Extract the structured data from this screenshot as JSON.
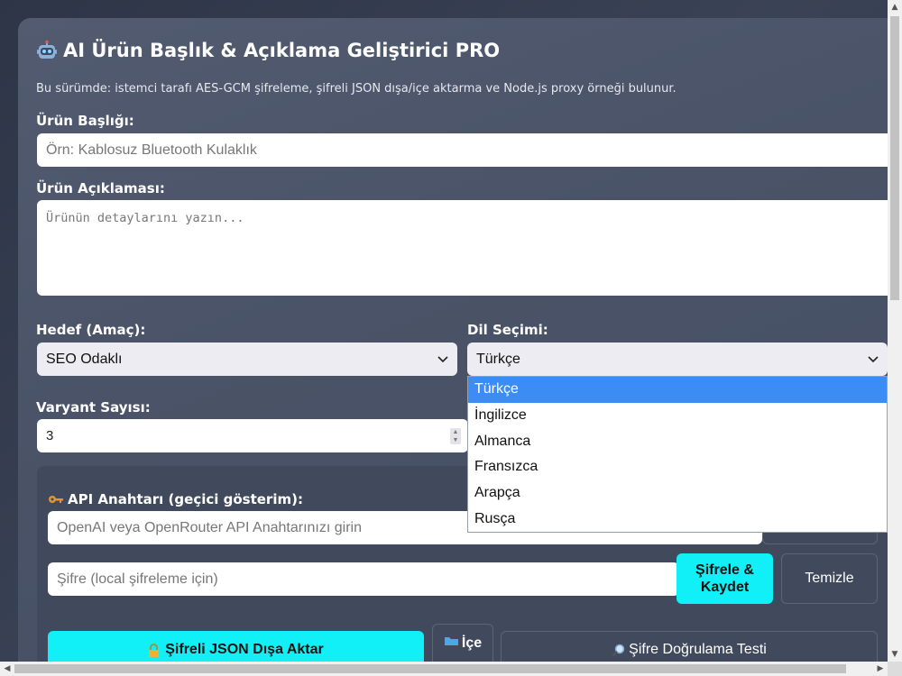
{
  "header": {
    "title": "AI Ürün Başlık & Açıklama Geliştirici PRO",
    "title_icon": "robot-icon",
    "subtitle": "Bu sürümde: istemci tarafı AES-GCM şifreleme, şifreli JSON dışa/içe aktarma ve Node.js proxy örneği bulunur."
  },
  "form": {
    "product_title": {
      "label": "Ürün Başlığı:",
      "placeholder": "Örn: Kablosuz Bluetooth Kulaklık",
      "value": ""
    },
    "product_desc": {
      "label": "Ürün Açıklaması:",
      "placeholder": "Ürünün detaylarını yazın...",
      "value": ""
    },
    "goal": {
      "label": "Hedef (Amaç):",
      "selected": "SEO Odaklı"
    },
    "language": {
      "label": "Dil Seçimi:",
      "selected": "Türkçe",
      "options": [
        "Türkçe",
        "İngilizce",
        "Almanca",
        "Fransızca",
        "Arapça",
        "Rusça"
      ]
    },
    "variants": {
      "label": "Varyant Sayısı:",
      "value": "3"
    }
  },
  "api_panel": {
    "label": "API Anahtarı (geçici gösterim):",
    "label_icon": "key-icon",
    "api_key_placeholder": "OpenAI veya OpenRouter API Anahtarınızı girin",
    "password_placeholder": "Şifre (local şifreleme için)",
    "encrypt_save": "Şifrele & Kaydet",
    "clear": "Temizle",
    "export_json": "Şifreli JSON Dışa Aktar",
    "import_json": "İçe",
    "password_test": "Şifre Doğrulama Testi"
  },
  "colors": {
    "accent": "#12f0f7",
    "selected_option": "#3b8cf5"
  }
}
